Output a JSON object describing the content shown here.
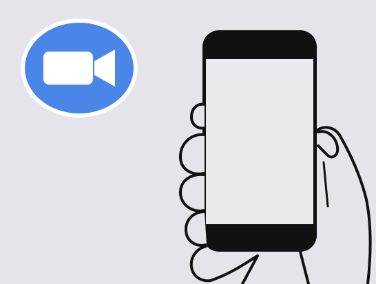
{
  "scene": {
    "background_color": "#e4e4ea",
    "app_icon": {
      "name": "video-camera-icon",
      "brand_color": "#4a86e8",
      "ring_color": "#ffffff",
      "glyph_color": "#ffffff"
    },
    "illustration": {
      "name": "hand-holding-phone",
      "line_color": "#111111",
      "screen_color": "#e9e9ee",
      "bezel_color": "#111111"
    }
  }
}
